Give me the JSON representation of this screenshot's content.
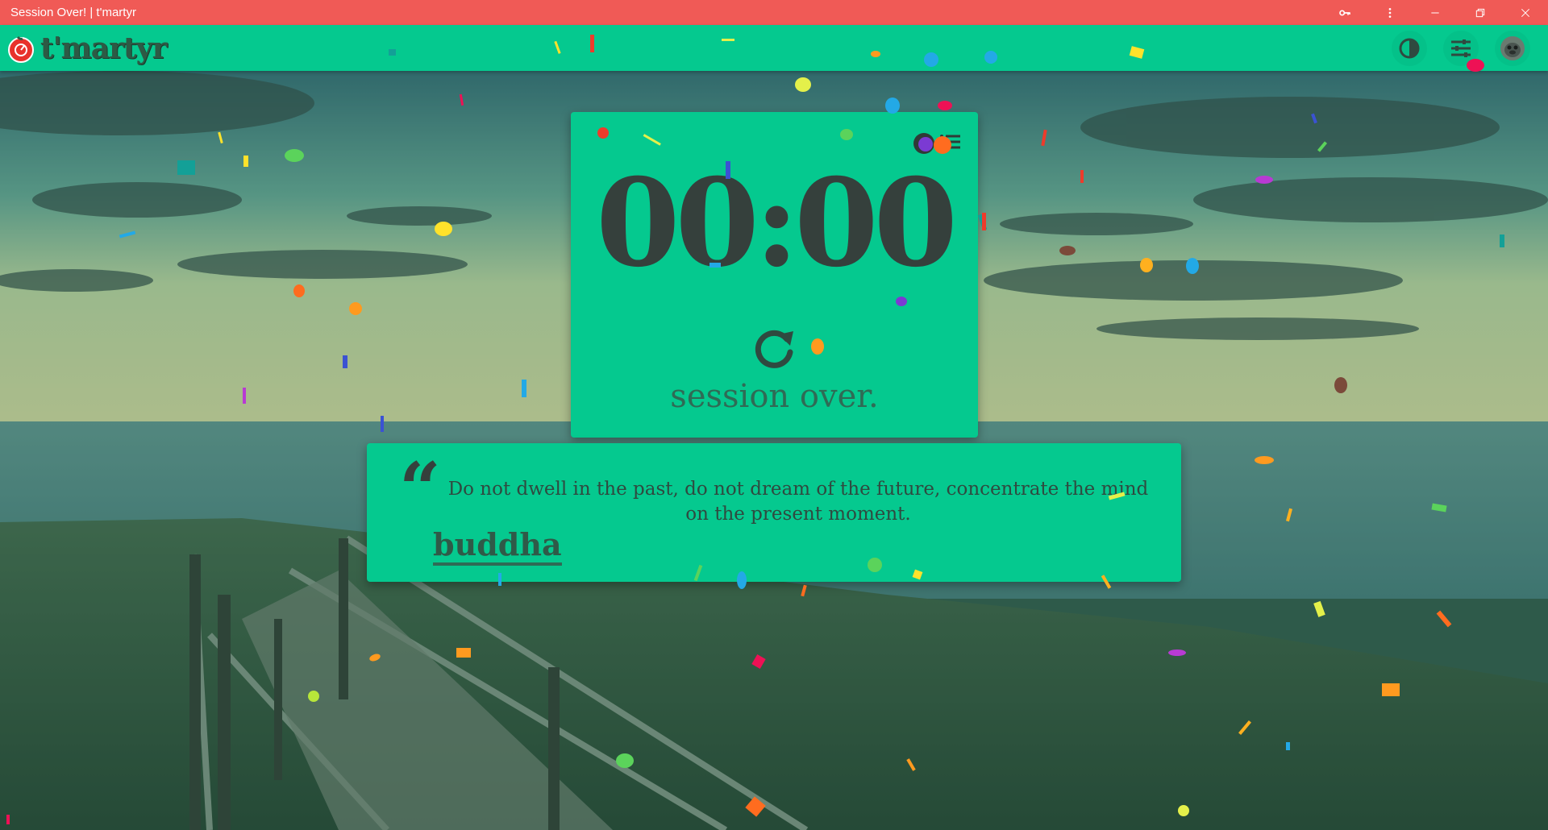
{
  "window": {
    "title": "Session Over! | t'martyr",
    "controls": [
      "key-icon",
      "more-vert-icon",
      "minimize-icon",
      "restore-icon",
      "close-icon"
    ]
  },
  "appbar": {
    "logo_text": "t'martyr",
    "icons": [
      "contrast-icon",
      "settings-sliders-icon",
      "avatar"
    ]
  },
  "timer": {
    "time": "00:00",
    "status": "session over.",
    "icons": [
      "info-icon",
      "list-icon",
      "restart-icon"
    ]
  },
  "quote": {
    "text": "Do not dwell in the past, do not dream of the future, concentrate the mind on the present moment.",
    "author": "buddha"
  },
  "colors": {
    "titlebar": "#f05a56",
    "accent": "#05c98f",
    "dark": "#35403c"
  }
}
